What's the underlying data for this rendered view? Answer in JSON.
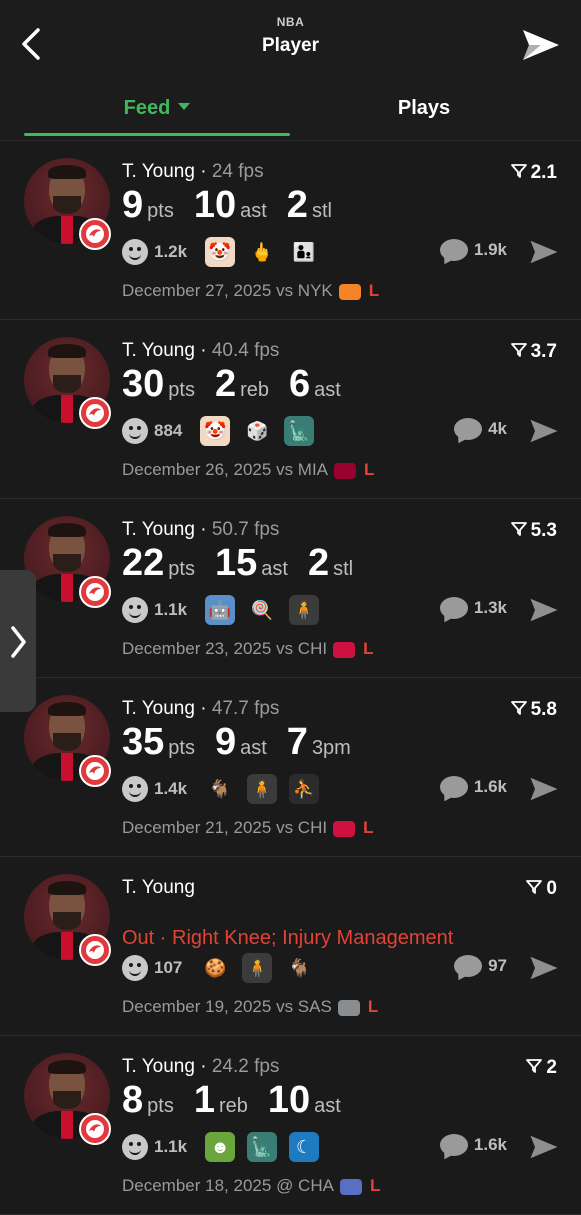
{
  "header": {
    "league": "NBA",
    "title": "Player"
  },
  "tabs": [
    {
      "label": "Feed",
      "active": true
    },
    {
      "label": "Plays",
      "active": false
    }
  ],
  "colors": {
    "accent": "#3fb95b",
    "loss": "#e34234",
    "hawks_red": "#e03a3e"
  },
  "cards": [
    {
      "player": "T. Young",
      "fps": "24 fps",
      "score": "2.1",
      "stats": [
        {
          "value": "9",
          "label": "pts"
        },
        {
          "value": "10",
          "label": "ast"
        },
        {
          "value": "2",
          "label": "stl"
        }
      ],
      "reactions": {
        "count": "1.2k",
        "emojis": [
          "clown-emoji",
          "middle-finger-emoji",
          "two-people-emoji"
        ]
      },
      "comments": "1.9k",
      "date": "December 27, 2025",
      "matchup": "vs NYK",
      "opponent_logo": "knicks-logo",
      "result": "L"
    },
    {
      "player": "T. Young",
      "fps": "40.4 fps",
      "score": "3.7",
      "stats": [
        {
          "value": "30",
          "label": "pts"
        },
        {
          "value": "2",
          "label": "reb"
        },
        {
          "value": "6",
          "label": "ast"
        }
      ],
      "reactions": {
        "count": "884",
        "emojis": [
          "clown-emoji",
          "dice-emoji",
          "statue-of-liberty-emoji"
        ]
      },
      "comments": "4k",
      "date": "December 26, 2025",
      "matchup": "vs MIA",
      "opponent_logo": "heat-logo",
      "result": "L"
    },
    {
      "player": "T. Young",
      "fps": "50.7 fps",
      "score": "5.3",
      "stats": [
        {
          "value": "22",
          "label": "pts"
        },
        {
          "value": "15",
          "label": "ast"
        },
        {
          "value": "2",
          "label": "stl"
        }
      ],
      "reactions": {
        "count": "1.1k",
        "emojis": [
          "robot-emoji",
          "lollipop-emoji",
          "person-emoji"
        ]
      },
      "comments": "1.3k",
      "date": "December 23, 2025",
      "matchup": "vs CHI",
      "opponent_logo": "bulls-logo",
      "result": "L"
    },
    {
      "player": "T. Young",
      "fps": "47.7 fps",
      "score": "5.8",
      "stats": [
        {
          "value": "35",
          "label": "pts"
        },
        {
          "value": "9",
          "label": "ast"
        },
        {
          "value": "7",
          "label": "3pm"
        }
      ],
      "reactions": {
        "count": "1.4k",
        "emojis": [
          "goat-emoji",
          "person-emoji",
          "player-emoji"
        ]
      },
      "comments": "1.6k",
      "date": "December 21, 2025",
      "matchup": "vs CHI",
      "opponent_logo": "bulls-logo",
      "result": "L"
    },
    {
      "player": "T. Young",
      "fps": "",
      "score": "0",
      "out_text": "Out · Right Knee; Injury Management",
      "stats": [],
      "reactions": {
        "count": "107",
        "emojis": [
          "cookie-emoji",
          "person-emoji",
          "goat-emoji"
        ]
      },
      "comments": "97",
      "date": "December 19, 2025",
      "matchup": "vs SAS",
      "opponent_logo": "spurs-logo",
      "result": "L"
    },
    {
      "player": "T. Young",
      "fps": "24.2 fps",
      "score": "2",
      "stats": [
        {
          "value": "8",
          "label": "pts"
        },
        {
          "value": "1",
          "label": "reb"
        },
        {
          "value": "10",
          "label": "ast"
        }
      ],
      "reactions": {
        "count": "1.1k",
        "emojis": [
          "shrek-emoji",
          "statue-of-liberty-emoji",
          "azerbaijan-flag-emoji"
        ]
      },
      "comments": "1.6k",
      "date": "December 18, 2025",
      "matchup": "@ CHA",
      "opponent_logo": "hornets-logo",
      "result": "L"
    }
  ]
}
